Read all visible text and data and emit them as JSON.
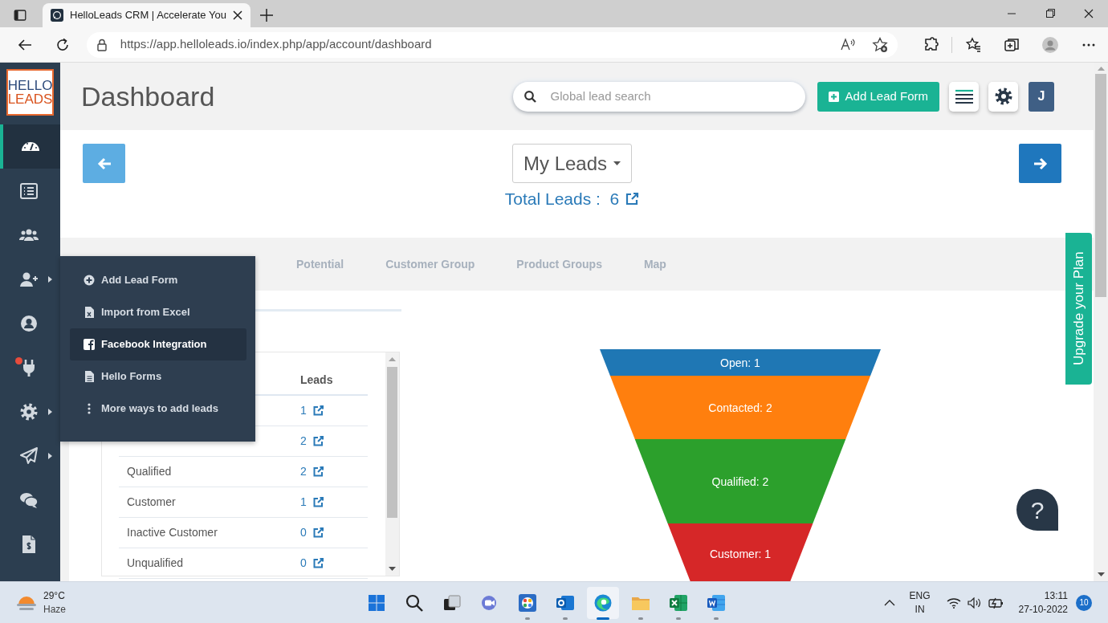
{
  "browser": {
    "tab_title": "HelloLeads CRM | Accelerate You",
    "url": "https://app.helloleads.io/index.php/app/account/dashboard"
  },
  "sidebar": {
    "logo_top": "HELLO",
    "logo_bottom": "LEADS",
    "items": [
      {
        "selected": true,
        "submenu": false,
        "alert": false
      },
      {
        "selected": false,
        "submenu": false,
        "alert": false
      },
      {
        "selected": false,
        "submenu": false,
        "alert": false
      },
      {
        "selected": false,
        "submenu": true,
        "alert": false
      },
      {
        "selected": false,
        "submenu": false,
        "alert": false
      },
      {
        "selected": false,
        "submenu": false,
        "alert": true
      },
      {
        "selected": false,
        "submenu": true,
        "alert": false
      },
      {
        "selected": false,
        "submenu": true,
        "alert": false
      },
      {
        "selected": false,
        "submenu": false,
        "alert": false
      },
      {
        "selected": false,
        "submenu": false,
        "alert": false
      }
    ]
  },
  "header": {
    "title": "Dashboard",
    "search": {
      "placeholder": "Global lead search"
    },
    "add_button": "Add Lead Form",
    "avatar": "J"
  },
  "leads_panel": {
    "owner_filter": "My Leads",
    "total": "Total Leads :  6"
  },
  "tabs": [
    {
      "label": "Potential",
      "selected": false
    },
    {
      "label": "Customer Group",
      "selected": false
    },
    {
      "label": "Product Groups",
      "selected": false
    },
    {
      "label": "Map",
      "selected": false
    }
  ],
  "flyout_menu": [
    {
      "label": "Add Lead Form",
      "selected": false
    },
    {
      "label": "Import from Excel",
      "selected": false
    },
    {
      "label": "Facebook Integration",
      "selected": true
    },
    {
      "label": "Hello Forms",
      "selected": false
    },
    {
      "label": "More ways to add leads",
      "selected": false
    }
  ],
  "status_table": {
    "leads_header": "Leads",
    "rows": [
      {
        "leads": "1"
      },
      {
        "leads": "2"
      },
      {
        "stage": "Qualified",
        "leads": "2"
      },
      {
        "stage": "Customer",
        "leads": "1"
      },
      {
        "stage": "Inactive Customer",
        "leads": "0"
      },
      {
        "stage": "Unqualified",
        "leads": "0"
      }
    ]
  },
  "funnel": {
    "stages": [
      {
        "label": "Open: 1",
        "color": "#1f77b4"
      },
      {
        "label": "Contacted: 2",
        "color": "#ff7f0e"
      },
      {
        "label": "Qualified: 2",
        "color": "#2ca02c"
      },
      {
        "label": "Customer: 1",
        "color": "#d62728"
      }
    ]
  },
  "upgrade_tab": "Upgrade your Plan",
  "help_button": "?",
  "taskbar": {
    "weather_temp": "29°C",
    "weather_text": "Haze",
    "apps": [
      {
        "running": false,
        "active": false
      },
      {
        "running": false,
        "active": false
      },
      {
        "running": false,
        "active": false
      },
      {
        "running": false,
        "active": false
      },
      {
        "running": true,
        "active": false
      },
      {
        "running": true,
        "active": false
      },
      {
        "running": true,
        "active": true
      },
      {
        "running": true,
        "active": false
      },
      {
        "running": true,
        "active": false
      },
      {
        "running": true,
        "active": false
      }
    ],
    "language": "ENG",
    "region": "IN",
    "time": "13:11",
    "date": "27-10-2022",
    "notifications": "10"
  }
}
